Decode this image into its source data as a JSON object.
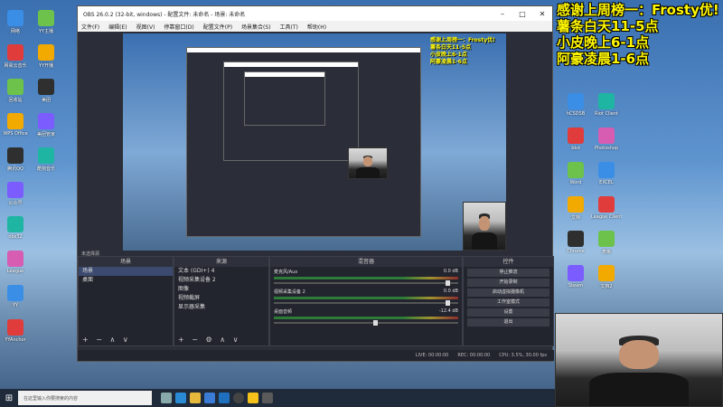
{
  "window": {
    "title": "OBS 26.0.2 (32-bit, windows) - 配置文件: 未命名 - 场景: 未命名",
    "menu": [
      "文件(F)",
      "编辑(E)",
      "视图(V)",
      "停靠窗口(D)",
      "配置文件(P)",
      "场景集合(S)",
      "工具(T)",
      "帮助(H)"
    ]
  },
  "overlay": {
    "lines": [
      "感谢上周榜一：Frosty优!",
      "薯条白天11-5点",
      "小皮晚上6-1点",
      "阿豪凌晨1-6点"
    ]
  },
  "preview_overlay": {
    "lines": [
      "感谢上周榜一：Frosty优!",
      "薯条白天11-5点",
      "小皮晚上6-1点",
      "阿豪凌晨1-6点"
    ]
  },
  "docks": {
    "status_label": "未选择源",
    "scenes": {
      "header": "场景",
      "items": [
        "场景",
        "桌面"
      ]
    },
    "sources": {
      "header": "来源",
      "items": [
        "文本 (GDI+) 4",
        "视频采集设备 2",
        "图像",
        "视频截屏",
        "显示器采集"
      ]
    },
    "mixer": {
      "header": "混音器",
      "channels": [
        {
          "name": "麦克风/Aux",
          "db": "0.0 dB"
        },
        {
          "name": "视频采集设备 2",
          "db": "0.0 dB"
        },
        {
          "name": "桌面音频",
          "db": "-12.4 dB"
        }
      ]
    },
    "controls": {
      "header": "控件",
      "buttons": [
        "停止推流",
        "开始录制",
        "启动虚拟摄像机",
        "工作室模式",
        "设置",
        "退出"
      ]
    },
    "transitions": {
      "header": "转场特效",
      "type": "淡出",
      "duration_label": "时长",
      "duration": "0 ms"
    }
  },
  "statusbar": {
    "live": "LIVE: 00:00:00",
    "rec": "REC: 00:00:00",
    "cpu": "CPU: 3.5%, 30.00 fps"
  },
  "desktop_left": [
    "网络",
    "网易云音乐",
    "回收站",
    "WPS Office",
    "腾讯QQ",
    "公众号",
    "obs32",
    "League",
    "YY",
    "YYAnchor",
    "YY主播",
    "YY开播",
    "美团",
    "美团管家",
    "酷狗音乐"
  ],
  "desktop_right": [
    "hCSDSB",
    "bbd",
    "Word",
    "文档",
    "Chrome",
    "Steam",
    "Riot Client",
    "Photoshop",
    "EXCEL",
    "League Client",
    "表格",
    "文档2"
  ],
  "taskbar": {
    "search_placeholder": "在这里输入你要搜索的内容"
  },
  "colors": {
    "overlay_text": "#fff700",
    "obs_bg": "#2b2e38"
  }
}
